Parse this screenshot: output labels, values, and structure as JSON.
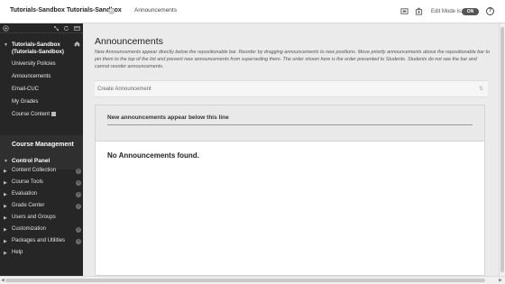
{
  "header": {
    "course_title": "Tutorials-Sandbox Tutorials-Sandbox",
    "breadcrumb": "Announcements",
    "edit_mode_label": "Edit Mode is:",
    "edit_mode_state": "ON",
    "help_glyph": "?"
  },
  "sidebar": {
    "course_name": "Tutorials-Sandbox (Tutorials-Sandbox)",
    "items": [
      {
        "label": "University Policies"
      },
      {
        "label": "Announcements"
      },
      {
        "label": "Email-CUC"
      },
      {
        "label": "My Grades"
      },
      {
        "label": "Course Content"
      }
    ],
    "section_title": "Course Management",
    "control_panel": {
      "title": "Control Panel",
      "items": [
        {
          "label": "Content Collection",
          "expandable": true
        },
        {
          "label": "Course Tools",
          "expandable": true
        },
        {
          "label": "Evaluation",
          "expandable": true
        },
        {
          "label": "Grade Center",
          "expandable": true
        },
        {
          "label": "Users and Groups",
          "expandable": false
        },
        {
          "label": "Customization",
          "expandable": true
        },
        {
          "label": "Packages and Utilities",
          "expandable": true
        },
        {
          "label": "Help",
          "expandable": false
        }
      ]
    }
  },
  "main": {
    "title": "Announcements",
    "description": "New Announcements appear directly below the repositionable bar. Reorder by dragging announcements to new positions. Move priority announcements above the repositionable bar to pin them to the top of the list and prevent new announcements from superseding them. The order shown here is the order presented to Students. Students do not see the bar and cannot reorder announcements.",
    "create_button": "Create Announcement",
    "divider_label": "New announcements appear below this line",
    "empty_message": "No Announcements found."
  },
  "colors": {
    "sidebar_bg": "#262626",
    "main_bg": "#ebebeb",
    "toggle_bg": "#555555"
  }
}
